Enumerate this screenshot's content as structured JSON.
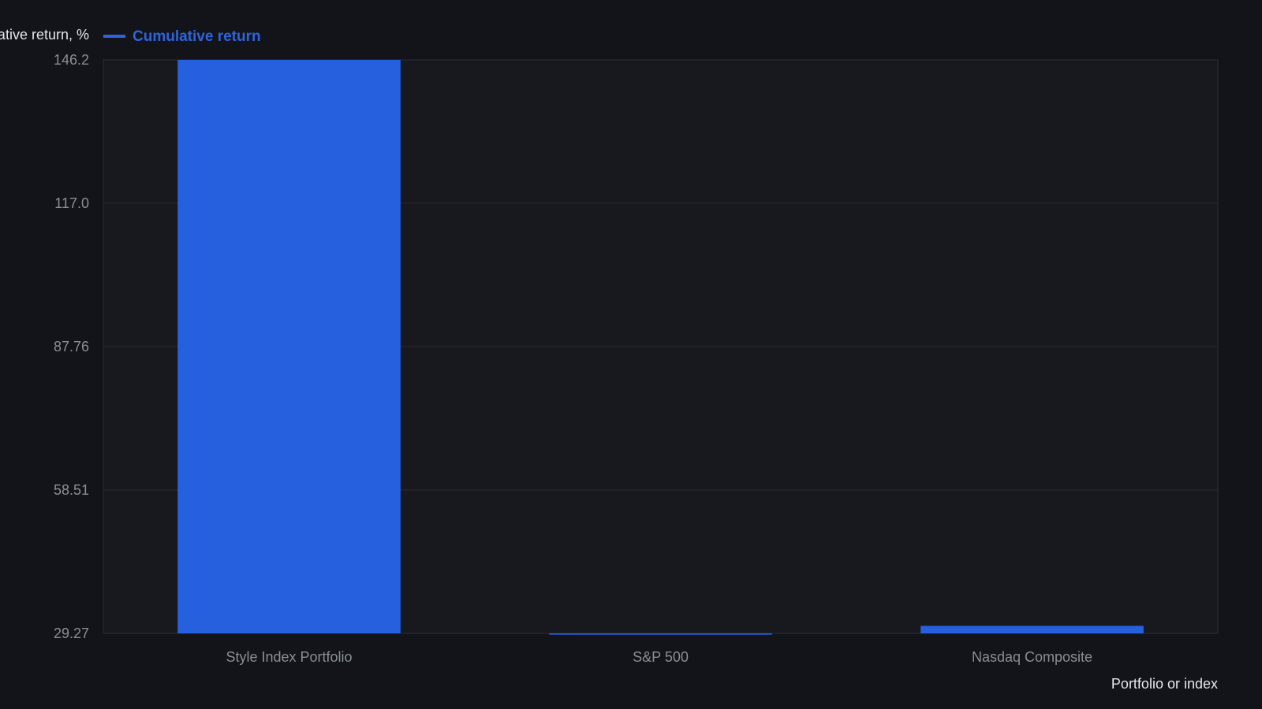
{
  "chart_data": {
    "type": "bar",
    "title": "",
    "ylabel": "Cumulative return, %",
    "xlabel": "Portfolio or index",
    "categories": [
      "Style Index Portfolio",
      "S&P 500",
      "Nasdaq Composite"
    ],
    "series": [
      {
        "name": "Cumulative return",
        "values": [
          146.2,
          29.0,
          30.8
        ]
      }
    ],
    "ylim": [
      29.27,
      146.2
    ],
    "yticks": [
      "29.27",
      "58.51",
      "87.76",
      "117.0",
      "146.2"
    ],
    "grid": true,
    "legend_position": "top-left",
    "colors": {
      "background": "#121419",
      "plot_background": "#17191e",
      "bar": "#2660df",
      "legend_text": "#2f63dc",
      "grid": "#272a31",
      "tick_text": "#8a8e96",
      "axis_title": "#e4e6ea"
    }
  }
}
